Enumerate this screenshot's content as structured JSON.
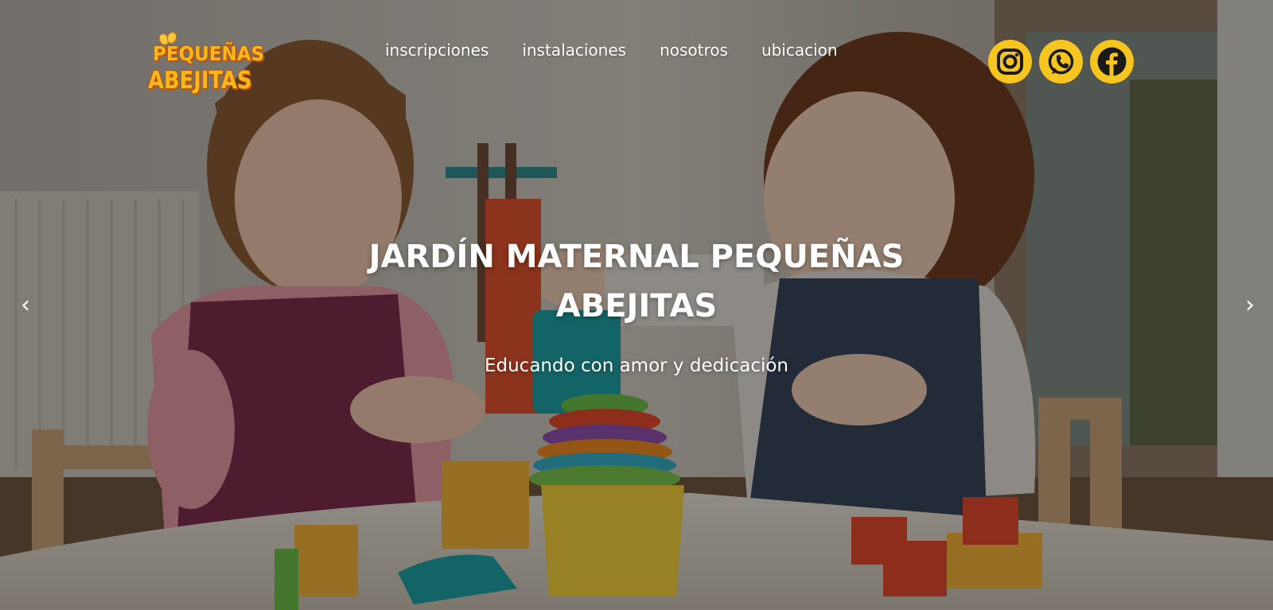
{
  "brand": {
    "logo_line1": "PEQUEÑAS",
    "logo_line2": "ABEJITAS",
    "accent_color": "#f7c51f"
  },
  "nav": {
    "items": [
      {
        "label": "inscripciones"
      },
      {
        "label": "instalaciones"
      },
      {
        "label": "nosotros"
      },
      {
        "label": "ubicacion"
      }
    ]
  },
  "social": {
    "icons": [
      "instagram-icon",
      "whatsapp-icon",
      "facebook-icon"
    ]
  },
  "hero": {
    "title": "JARDÍN MATERNAL PEQUEÑAS ABEJITAS",
    "subtitle": "Educando con amor y dedicación"
  },
  "carousel": {
    "prev_label": "‹",
    "next_label": "›"
  }
}
